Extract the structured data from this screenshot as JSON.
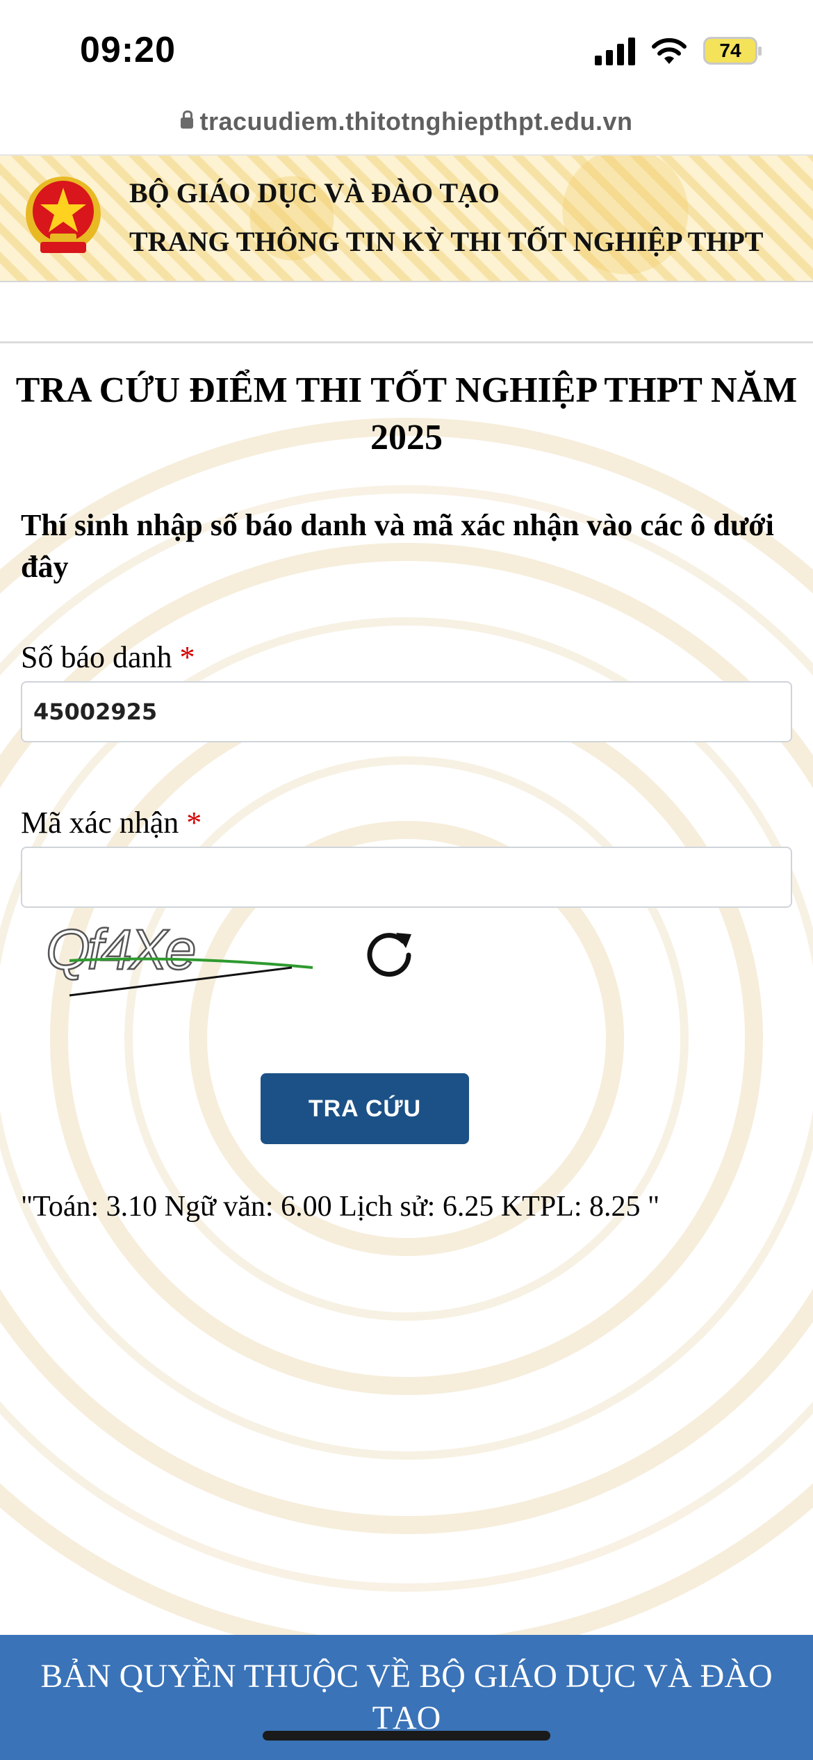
{
  "status_bar": {
    "time": "09:20",
    "battery_level": "74",
    "icons": [
      "cellular-signal-icon",
      "wifi-icon",
      "battery-charging-icon"
    ]
  },
  "browser": {
    "url": "tracuudiem.thitotnghiepthpt.edu.vn"
  },
  "header": {
    "org_name": "BỘ GIÁO DỤC VÀ ĐÀO TẠO",
    "site_name": "TRANG THÔNG TIN KỲ THI TỐT NGHIỆP THPT"
  },
  "main": {
    "title": "TRA CỨU ĐIỂM THI TỐT NGHIỆP THPT NĂM 2025",
    "instruction": "Thí sinh nhập số báo danh và mã xác nhận vào các ô dưới đây",
    "candidate_id": {
      "label": "Số báo danh",
      "required_marker": "*",
      "value": "45002925"
    },
    "captcha_field": {
      "label": "Mã xác nhận",
      "required_marker": "*",
      "value": ""
    },
    "captcha_text": "Qf4Xe",
    "submit_label": "TRA CỨU",
    "result_text": "\"Toán: 3.10 Ngữ văn: 6.00 Lịch sử: 6.25 KTPL: 8.25 \""
  },
  "footer": {
    "copyright": "BẢN QUYỀN THUỘC VỀ BỘ GIÁO DỤC VÀ ĐÀO TẠO"
  },
  "colors": {
    "footer_bg": "#3a73b8",
    "button_bg": "#1b5186",
    "required": "#d40000"
  }
}
